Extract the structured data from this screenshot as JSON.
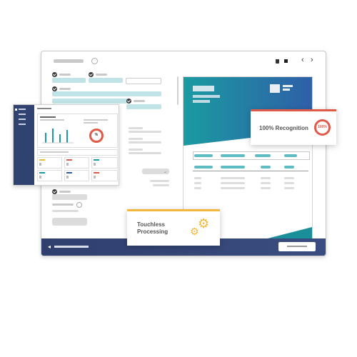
{
  "cards": {
    "recognition": {
      "label": "100% Recognition",
      "value": "100%"
    },
    "touchless": {
      "line1": "Touchless",
      "line2": "Processing"
    }
  },
  "dashboard": {
    "gauge_label": "%"
  },
  "window": {
    "nav": {
      "prev": "‹",
      "next": "›"
    }
  },
  "colors": {
    "accent_teal": "#1a9ba1",
    "accent_blue": "#2f5fa8",
    "footer_navy": "#2f3f6e",
    "recognition_red": "#e05a4a",
    "touchless_yellow": "#f2b83c"
  }
}
